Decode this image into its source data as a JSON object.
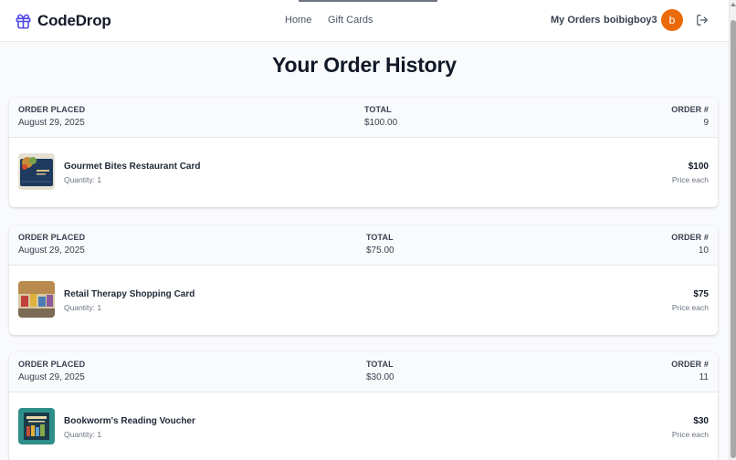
{
  "nav": {
    "brand": "CodeDrop",
    "links": [
      "Home",
      "Gift Cards"
    ],
    "my_orders": "My Orders",
    "username": "boibigboy3",
    "avatar_initial": "b",
    "brand_icon": "gift-icon",
    "logout_icon": "logout-icon"
  },
  "colors": {
    "brand": "#4f46e5",
    "avatar": "#ea6a0a"
  },
  "page": {
    "title": "Your Order History"
  },
  "labels": {
    "order_placed": "ORDER PLACED",
    "total": "TOTAL",
    "order_number": "ORDER #",
    "price_each": "Price each"
  },
  "orders": [
    {
      "date": "August 29, 2025",
      "total": "$100.00",
      "number": "9",
      "item": {
        "name": "Gourmet Bites Restaurant Card",
        "quantity": "Quantity: 1",
        "price": "$100"
      }
    },
    {
      "date": "August 29, 2025",
      "total": "$75.00",
      "number": "10",
      "item": {
        "name": "Retail Therapy Shopping Card",
        "quantity": "Quantity: 1",
        "price": "$75"
      }
    },
    {
      "date": "August 29, 2025",
      "total": "$30.00",
      "number": "11",
      "item": {
        "name": "Bookworm's Reading Voucher",
        "quantity": "Quantity: 1",
        "price": "$30"
      }
    }
  ]
}
